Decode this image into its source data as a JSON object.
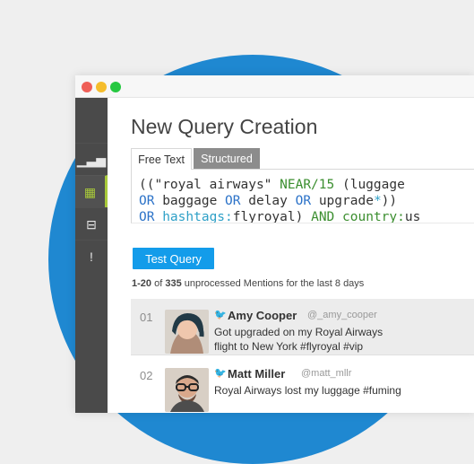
{
  "window": {
    "traffic_lights": {
      "close": "#ef5f57",
      "minimize": "#f5bd2c",
      "maximize": "#26c841"
    }
  },
  "colors": {
    "background": "#efefef",
    "circle": "#1f88d1",
    "sidebar": "#4a4a4a",
    "active_accent": "#a8c93a",
    "button": "#139cea",
    "twitter_blue": "#55acee"
  },
  "sidebar": {
    "items": [
      {
        "icon": "bar-chart-icon",
        "glyph": "▁▃▅",
        "active": false
      },
      {
        "icon": "grid-icon",
        "glyph": "▦",
        "active": true
      },
      {
        "icon": "hierarchy-icon",
        "glyph": "⊟",
        "active": false
      },
      {
        "icon": "alert-icon",
        "glyph": "!",
        "active": false
      }
    ]
  },
  "main": {
    "title": "New Query Creation",
    "tabs": [
      {
        "label": "Free Text",
        "active": true
      },
      {
        "label": "Structured",
        "active": false
      }
    ],
    "query": {
      "line1_part1": "((\"royal airways\" ",
      "line1_near": "NEAR/15",
      "line1_part2": " (luggage",
      "line2_or1": "OR",
      "line2_baggage": " baggage ",
      "line2_or2": "OR",
      "line2_delay": " delay ",
      "line2_or3": "OR",
      "line2_upgrade": " upgrade",
      "line2_wild": "*",
      "line2_close": "))",
      "line3_or": "OR",
      "line3_space": " ",
      "line3_hashtags": "hashtags:",
      "line3_flyroyal": "flyroyal) ",
      "line3_and": "AND",
      "line3_space2": " ",
      "line3_country": "country:",
      "line3_us": "us"
    },
    "test_button_label": "Test Query",
    "summary": {
      "range": "1-20",
      "of": " of ",
      "count": "335",
      "text": " unprocessed Mentions for the last 8 days"
    },
    "mentions": [
      {
        "index": "01",
        "name": "Amy Cooper",
        "handle": "@_amy_cooper",
        "text": "Got upgraded on my Royal Airways flight to New York #flyroyal #vip"
      },
      {
        "index": "02",
        "name": "Matt Miller",
        "handle": "@matt_mllr",
        "text": "Royal Airways lost my luggage #fuming"
      }
    ]
  }
}
